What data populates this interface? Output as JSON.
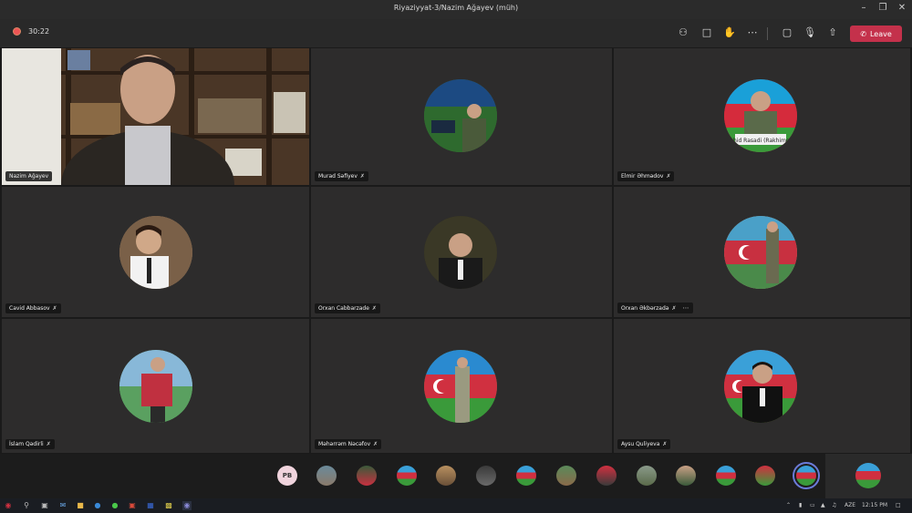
{
  "window": {
    "title": "Riyaziyyat-3/Nazim Ağayev (müh)"
  },
  "toolbar": {
    "timer": "30:22",
    "leave_label": "Leave"
  },
  "participants": [
    {
      "name": "Nazim Ağayev",
      "muted": false
    },
    {
      "name": "Murad Səfiyev",
      "muted": true
    },
    {
      "name": "Elmir Əhmədov",
      "muted": true
    },
    {
      "name": "Cavid Abbasov",
      "muted": true
    },
    {
      "name": "Orxan Cabbarzade",
      "muted": true
    },
    {
      "name": "Orxan Əkbərzadə",
      "muted": true
    },
    {
      "name": "İslam Qədirli",
      "muted": true
    },
    {
      "name": "Məhərrəm Nəcəfov",
      "muted": true
    },
    {
      "name": "Aysu Quliyeva",
      "muted": true
    }
  ],
  "tile2_caption": "Sahid Rasadi (Rakhimov)",
  "tray": {
    "initials": "PB"
  },
  "taskbar": {
    "lang": "AZE",
    "time": "12:15 PM"
  },
  "colors": {
    "leave": "#c4314b",
    "tile": "#2d2c2c"
  }
}
